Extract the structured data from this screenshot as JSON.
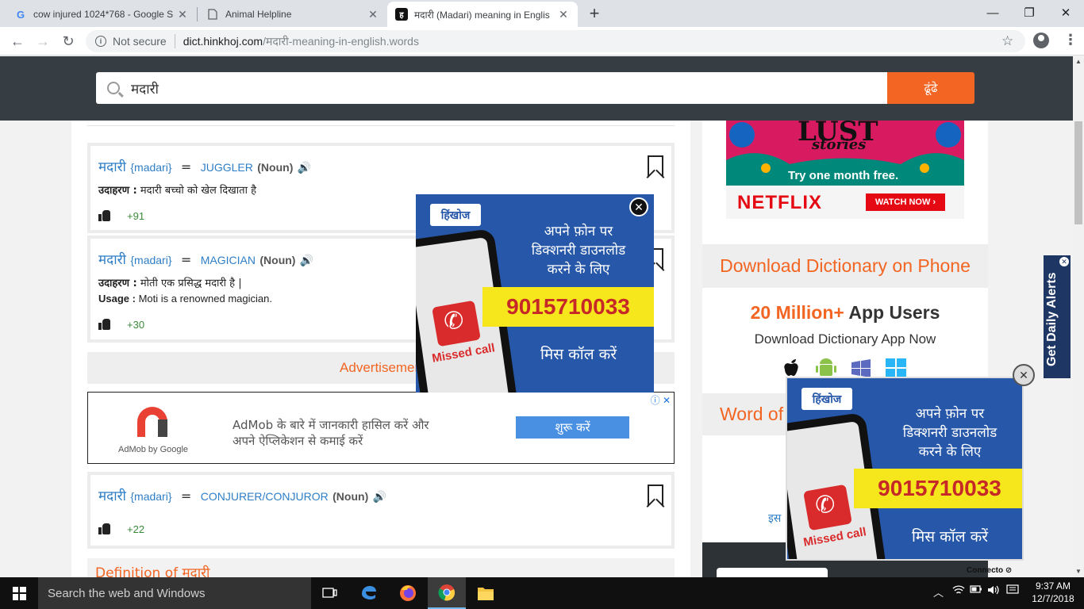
{
  "browser": {
    "tabs": [
      {
        "title": "cow injured 1024*768 - Google S",
        "favicon": "google-icon",
        "active": false
      },
      {
        "title": "Animal Helpline",
        "favicon": "page-icon",
        "active": false
      },
      {
        "title": "मदारी (Madari) meaning in Englis",
        "favicon": "hinkhoj-icon",
        "active": true
      }
    ],
    "new_tab": "+",
    "security": "Not secure",
    "url_host": "dict.hinkhoj.com",
    "url_path": "/मदारी-meaning-in-english.words"
  },
  "search": {
    "value": "मदारी",
    "button": "ढूंढे"
  },
  "entries": [
    {
      "word": "मदारी",
      "translit": "{madari}",
      "eq": "=",
      "meaning": "JUGGLER",
      "pos": "(Noun)",
      "example_label": "उदाहरण :",
      "example": "मदारी बच्चो को खेल दिखाता है",
      "likes": "+91"
    },
    {
      "word": "मदारी",
      "translit": "{madari}",
      "eq": "=",
      "meaning": "MAGICIAN",
      "pos": "(Noun)",
      "example_label": "उदाहरण :",
      "example": "मोती एक प्रसिद्ध मदारी है |",
      "usage_label": "Usage :",
      "usage": "Moti is a renowned magician.",
      "likes": "+30"
    },
    {
      "word": "मदारी",
      "translit": "{madari}",
      "eq": "=",
      "meaning": "CONJURER/CONJUROR",
      "pos": "(Noun)",
      "likes": "+22"
    }
  ],
  "ad_label": "Advertisemen",
  "admob": {
    "logo_text": "AdMob by Google",
    "text_line1": "AdMob के बारे में जानकारी हासिल करें और",
    "text_line2": "अपने ऐप्लिकेशन से कमाई करें",
    "button": "शुरू करें"
  },
  "definition_heading": "Definition of मदारी",
  "netflix_ad": {
    "title": "LUST",
    "subtitle": "stories",
    "tagline": "Try one month free.",
    "brand": "NETFLIX",
    "cta": "WATCH NOW ›"
  },
  "sidebar": {
    "download_heading": "Download Dictionary on Phone",
    "users_num": "20 Million+",
    "users_text": " App Users",
    "download_sub": "Download Dictionary App Now",
    "word_of_day": "Word of",
    "is_text": "इस",
    "connecto": "Connecto"
  },
  "promo_ad": {
    "brand": "हिंखोज",
    "line1": "अपने फ़ोन पर",
    "line2": "डिक्शनरी डाउनलोड",
    "line3": "करने के लिए",
    "number": "9015710033",
    "missed": "Missed call",
    "cta": "मिस कॉल करें"
  },
  "side_alert": "Get Daily Alerts",
  "taskbar": {
    "search_placeholder": "Search the web and Windows",
    "time": "9:37 AM",
    "date": "12/7/2018"
  },
  "colors": {
    "accent": "#f26522",
    "link": "#2e7ec6",
    "header": "#373e43",
    "promo": "#2657a8"
  }
}
